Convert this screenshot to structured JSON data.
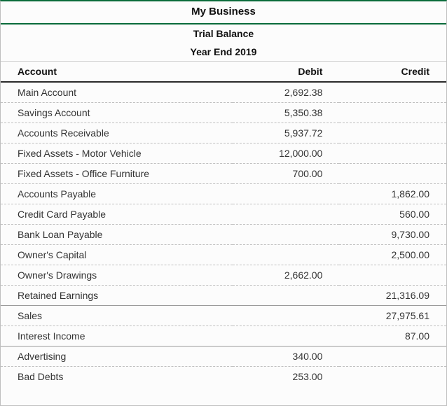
{
  "title": "My Business",
  "subtitle": "Trial Balance",
  "period": "Year End 2019",
  "headers": {
    "account": "Account",
    "debit": "Debit",
    "credit": "Credit"
  },
  "rows": [
    {
      "account": "Main Account",
      "debit": "2,692.38",
      "credit": "",
      "section_end": false
    },
    {
      "account": "Savings Account",
      "debit": "5,350.38",
      "credit": "",
      "section_end": false
    },
    {
      "account": "Accounts Receivable",
      "debit": "5,937.72",
      "credit": "",
      "section_end": false
    },
    {
      "account": "Fixed Assets - Motor Vehicle",
      "debit": "12,000.00",
      "credit": "",
      "section_end": false
    },
    {
      "account": "Fixed Assets - Office Furniture",
      "debit": "700.00",
      "credit": "",
      "section_end": false
    },
    {
      "account": "Accounts Payable",
      "debit": "",
      "credit": "1,862.00",
      "section_end": false
    },
    {
      "account": "Credit Card Payable",
      "debit": "",
      "credit": "560.00",
      "section_end": false
    },
    {
      "account": "Bank Loan Payable",
      "debit": "",
      "credit": "9,730.00",
      "section_end": false
    },
    {
      "account": "Owner's Capital",
      "debit": "",
      "credit": "2,500.00",
      "section_end": false
    },
    {
      "account": "Owner's Drawings",
      "debit": "2,662.00",
      "credit": "",
      "section_end": false
    },
    {
      "account": "Retained Earnings",
      "debit": "",
      "credit": "21,316.09",
      "section_end": true
    },
    {
      "account": "Sales",
      "debit": "",
      "credit": "27,975.61",
      "section_end": false
    },
    {
      "account": "Interest Income",
      "debit": "",
      "credit": "87.00",
      "section_end": true
    },
    {
      "account": "Advertising",
      "debit": "340.00",
      "credit": "",
      "section_end": false
    },
    {
      "account": "Bad Debts",
      "debit": "253.00",
      "credit": "",
      "section_end": false,
      "partial": true
    }
  ]
}
